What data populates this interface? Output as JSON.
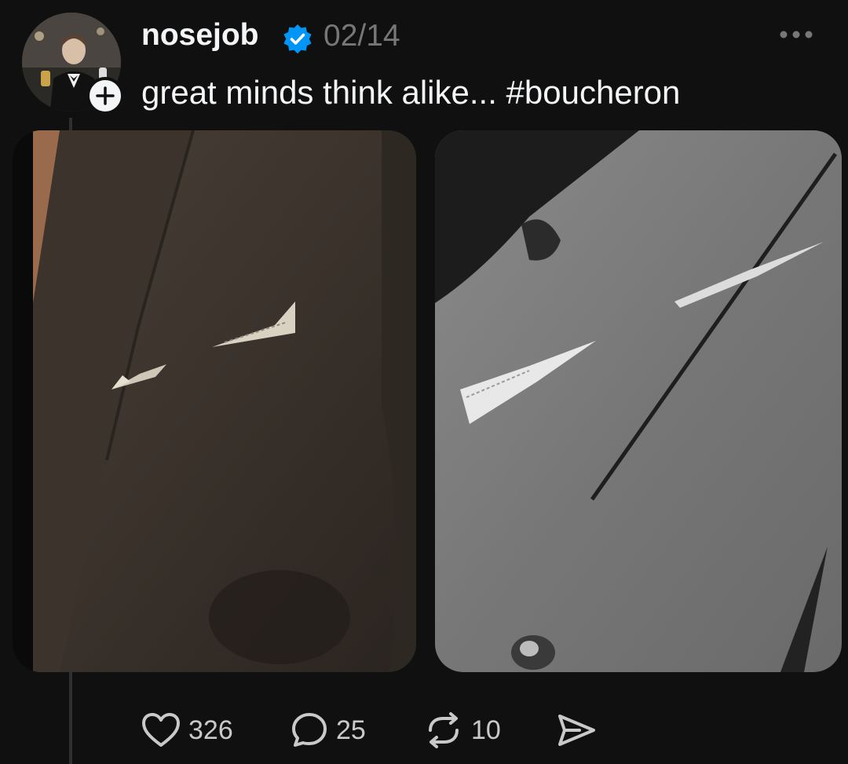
{
  "post": {
    "username": "nosejob",
    "timestamp": "02/14",
    "caption": "great minds think alike... #boucheron",
    "verified_icon": "verified-badge-icon",
    "follow_icon": "plus-icon",
    "more_icon": "more-horizontal-icon"
  },
  "actions": {
    "likes": "326",
    "replies": "25",
    "reposts": "10",
    "like_icon": "heart-icon",
    "reply_icon": "speech-bubble-icon",
    "repost_icon": "repost-icon",
    "share_icon": "send-icon"
  },
  "colors": {
    "background": "#101010",
    "text": "#f3f5f7",
    "muted": "#777777",
    "verified": "#0095f6"
  }
}
